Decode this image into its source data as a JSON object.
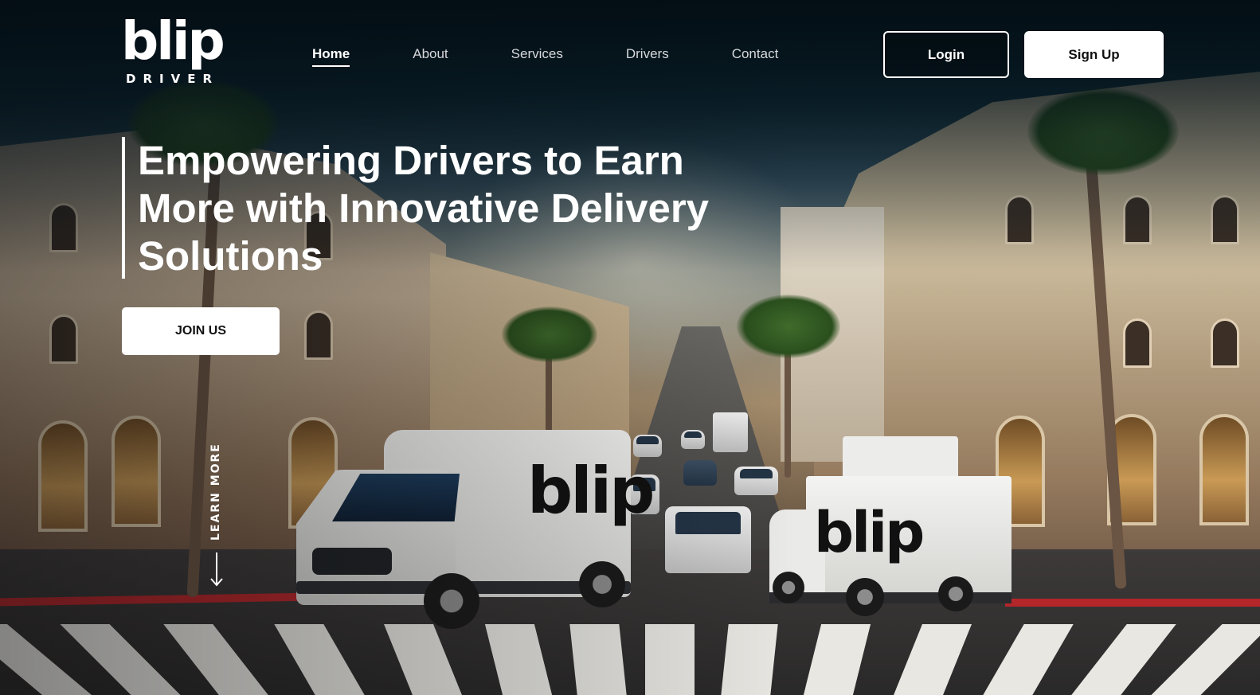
{
  "logo": {
    "word": "blip",
    "sub": "DRIVER"
  },
  "nav": {
    "items": [
      {
        "label": "Home",
        "active": true
      },
      {
        "label": "About",
        "active": false
      },
      {
        "label": "Services",
        "active": false
      },
      {
        "label": "Drivers",
        "active": false
      },
      {
        "label": "Contact",
        "active": false
      }
    ]
  },
  "header": {
    "login_label": "Login",
    "signup_label": "Sign Up"
  },
  "hero": {
    "title": "Empowering Drivers to Earn More with Innovative Delivery Solutions",
    "cta_label": "JOIN US",
    "learn_more_label": "LEARN MORE"
  },
  "scene": {
    "van_brand": "blip",
    "truck_brand": "blip"
  },
  "colors": {
    "accent": "#ffffff",
    "curb": "#b3262a",
    "overlay": "#04121a"
  },
  "icons": {
    "learn_more": "arrow-down-icon"
  }
}
